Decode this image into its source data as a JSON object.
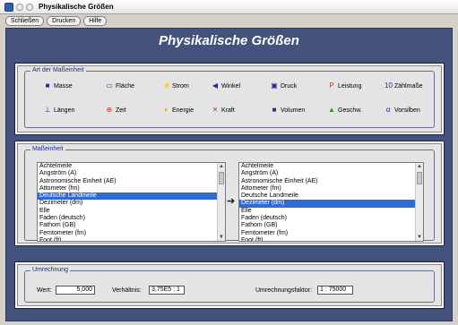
{
  "window": {
    "title": "Physikalische Größen"
  },
  "menu": {
    "items": [
      "Schließen",
      "Drucken",
      "Hilfe"
    ]
  },
  "header": {
    "title": "Physikalische Größen"
  },
  "art": {
    "legend": "Art der Maßeinheit",
    "units": [
      {
        "label": "Masse",
        "icon": "■",
        "color": "#1e2b8f"
      },
      {
        "label": "Fläche",
        "icon": "▭",
        "color": "#1e2b8f"
      },
      {
        "label": "Strom",
        "icon": "⚡",
        "color": "#c0392b"
      },
      {
        "label": "Winkel",
        "icon": "◀",
        "color": "#1e2b8f"
      },
      {
        "label": "Druck",
        "icon": "▣",
        "color": "#1e2b8f"
      },
      {
        "label": "Leistung",
        "icon": "P",
        "color": "#c0392b"
      },
      {
        "label": "Zählmaße",
        "icon": "10",
        "color": "#1e2b8f"
      },
      {
        "label": "Längen",
        "icon": "⊥",
        "color": "#1e2b8f"
      },
      {
        "label": "Zeit",
        "icon": "⊕",
        "color": "#c0392b"
      },
      {
        "label": "Energie",
        "icon": "♦",
        "color": "#e6b800"
      },
      {
        "label": "Kraft",
        "icon": "✕",
        "color": "#c0392b"
      },
      {
        "label": "Volumen",
        "icon": "■",
        "color": "#1e2b8f"
      },
      {
        "label": "Geschw.",
        "icon": "▲",
        "color": "#2f8a2f"
      },
      {
        "label": "Vorsilben",
        "icon": "α",
        "color": "#1e2b8f"
      }
    ]
  },
  "masseinheit": {
    "legend": "Maßeinheit",
    "left_items": [
      "Achtelmeile",
      "Angström (A)",
      "Astronomische Einheit (AE)",
      "Attometer (fm)",
      "Deutsche Landmeile",
      "Dezimeter (dm)",
      "Elle",
      "Faden (deutsch)",
      "Fathom (GB)",
      "Femtometer (fm)",
      "Foot (ft)"
    ],
    "left_selected": 4,
    "right_items": [
      "Achtelmeile",
      "Angström (A)",
      "Astronomische Einheit (AE)",
      "Attometer (fm)",
      "Deutsche Landmeile",
      "Dezimeter (dm)",
      "Elle",
      "Faden (deutsch)",
      "Fathom (GB)",
      "Femtometer (fm)",
      "Foot (ft)"
    ],
    "right_selected": 5,
    "arrow": "➔"
  },
  "umrechnung": {
    "legend": "Umrechnung",
    "wert_label": "Wert:",
    "wert_value": "5,000",
    "verhaeltnis_label": "Verhältnis:",
    "verhaeltnis_value": "3,75E5 : 1",
    "faktor_label": "Umrechnungsfaktor:",
    "faktor_value": "1 : 75000"
  }
}
